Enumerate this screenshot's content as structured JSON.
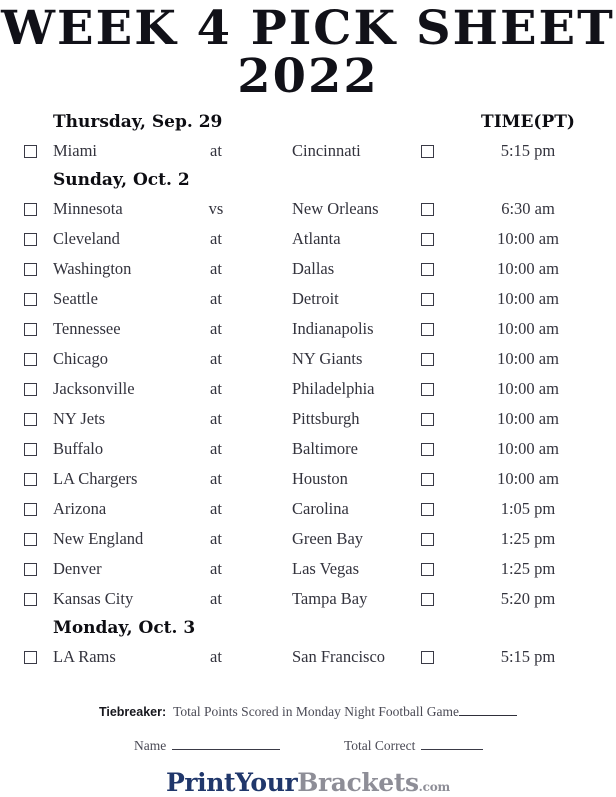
{
  "title": {
    "line1": "WEEK 4 PICK SHEET",
    "line2": "2022"
  },
  "columns": {
    "time_header": "TIME(PT)"
  },
  "sections": [
    {
      "heading": "Thursday, Sep. 29",
      "games": [
        {
          "away": "Miami",
          "sep": "at",
          "home": "Cincinnati",
          "time": "5:15 pm"
        }
      ]
    },
    {
      "heading": "Sunday, Oct. 2",
      "games": [
        {
          "away": "Minnesota",
          "sep": "vs",
          "home": "New Orleans",
          "time": "6:30 am"
        },
        {
          "away": "Cleveland",
          "sep": "at",
          "home": "Atlanta",
          "time": "10:00 am"
        },
        {
          "away": "Washington",
          "sep": "at",
          "home": "Dallas",
          "time": "10:00 am"
        },
        {
          "away": "Seattle",
          "sep": "at",
          "home": "Detroit",
          "time": "10:00 am"
        },
        {
          "away": "Tennessee",
          "sep": "at",
          "home": "Indianapolis",
          "time": "10:00 am"
        },
        {
          "away": "Chicago",
          "sep": "at",
          "home": "NY Giants",
          "time": "10:00 am"
        },
        {
          "away": "Jacksonville",
          "sep": "at",
          "home": "Philadelphia",
          "time": "10:00 am"
        },
        {
          "away": "NY Jets",
          "sep": "at",
          "home": "Pittsburgh",
          "time": "10:00 am"
        },
        {
          "away": "Buffalo",
          "sep": "at",
          "home": "Baltimore",
          "time": "10:00 am"
        },
        {
          "away": "LA Chargers",
          "sep": "at",
          "home": "Houston",
          "time": "10:00 am"
        },
        {
          "away": "Arizona",
          "sep": "at",
          "home": "Carolina",
          "time": "1:05 pm"
        },
        {
          "away": "New England",
          "sep": "at",
          "home": "Green Bay",
          "time": "1:25 pm"
        },
        {
          "away": "Denver",
          "sep": "at",
          "home": "Las Vegas",
          "time": "1:25 pm"
        },
        {
          "away": "Kansas City",
          "sep": "at",
          "home": "Tampa Bay",
          "time": "5:20 pm"
        }
      ]
    },
    {
      "heading": "Monday, Oct. 3",
      "games": [
        {
          "away": "LA Rams",
          "sep": "at",
          "home": "San Francisco",
          "time": "5:15 pm"
        }
      ]
    }
  ],
  "footer": {
    "tiebreaker_label": "Tiebreaker:",
    "tiebreaker_text": "Total Points Scored in Monday Night Football Game",
    "name_label": "Name",
    "total_correct_label": "Total Correct",
    "logo_part1": "PrintYour",
    "logo_part2": "Brackets",
    "logo_part3": ".com"
  },
  "colors": {
    "logo_navy": "#20376b",
    "logo_gray": "#8e8e97",
    "ink": "#33333d"
  }
}
